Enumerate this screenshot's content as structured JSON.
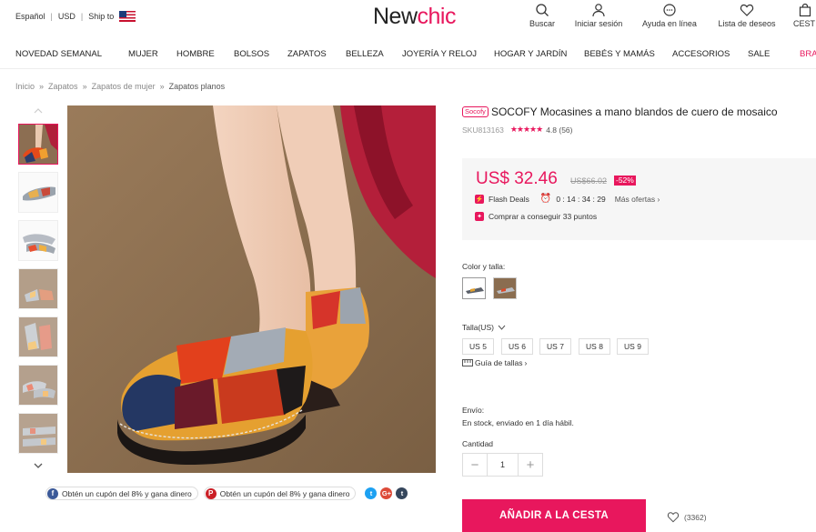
{
  "topbar": {
    "language": "Español",
    "currency": "USD",
    "ship_to": "Ship to",
    "logo_prefix": "New",
    "logo_suffix": "chic",
    "icons": [
      {
        "name": "search-icon",
        "label": "Buscar"
      },
      {
        "name": "user-icon",
        "label": "Iniciar sesión"
      },
      {
        "name": "chat-icon",
        "label": "Ayuda en línea"
      },
      {
        "name": "heart-icon",
        "label": "Lista de deseos"
      },
      {
        "name": "bag-icon",
        "label": "CEST"
      }
    ]
  },
  "nav": {
    "items": [
      "NOVEDAD SEMANAL",
      "MUJER",
      "HOMBRE",
      "BOLSOS",
      "ZAPATOS",
      "BELLEZA",
      "JOYERÍA Y RELOJ",
      "HOGAR Y JARDÍN",
      "BEBÉS Y MAMÁS",
      "ACCESORIOS",
      "SALE",
      "BRA"
    ]
  },
  "breadcrumb": [
    "Inicio",
    "Zapatos",
    "Zapatos de mujer",
    "Zapatos planos"
  ],
  "breadcrumb_sep": "»",
  "product": {
    "brand_tag": "Socofy",
    "title": "SOCOFY Mocasines a mano blandos de cuero de mosaico",
    "sku": "SKU813163",
    "stars": "★★★★★",
    "rating": "4.8 (56)",
    "price": "US$ 32.46",
    "old_price": "US$66.02",
    "discount": "-52%",
    "flash_label": "Flash Deals",
    "countdown": "0 : 14 : 34 : 29",
    "more_offers": "Más ofertas",
    "points": "Comprar a conseguir 33 puntos",
    "color_label": "Color y talla:",
    "size_label": "Talla(US)",
    "sizes": [
      "US 5",
      "US 6",
      "US 7",
      "US 8",
      "US 9"
    ],
    "size_guide": "Guía de tallas",
    "shipping_label": "Envío:",
    "shipping_text": "En stock, enviado en 1 día hábil.",
    "qty_label": "Cantidad",
    "qty": "1",
    "add_to_cart": "AÑADIR A LA CESTA",
    "wishlist_count": "(3362)"
  },
  "share": {
    "facebook": "Obtén un cupón del 8% y gana dinero",
    "pinterest": "Obtén un cupón del 8% y gana dinero"
  },
  "colors": {
    "accent": "#e8175d",
    "background_main": "#8a6e4f"
  }
}
